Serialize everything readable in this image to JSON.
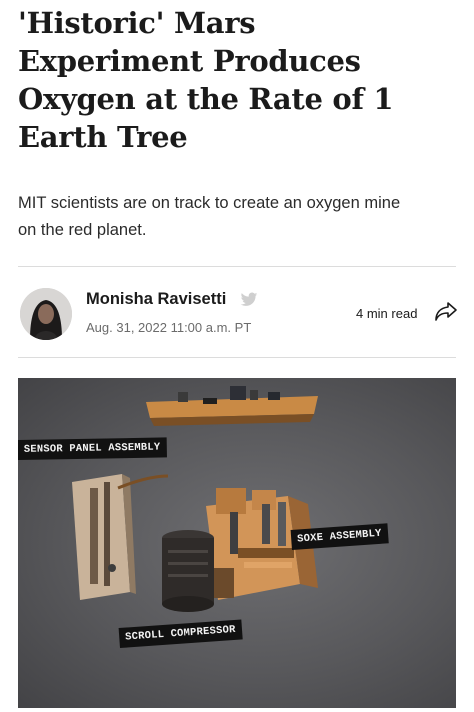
{
  "article": {
    "headline_lines": [
      "'Historic' Mars",
      "Experiment Produces",
      "Oxygen at the Rate of 1",
      "Earth Tree"
    ],
    "dek_lines": [
      "MIT scientists are on track to create an oxygen mine",
      "on the red planet."
    ]
  },
  "author": {
    "name": "Monisha Ravisetti",
    "date": "Aug. 31, 2022 11:00 a.m. PT",
    "twitter_icon": "twitter-icon",
    "avatar": "avatar"
  },
  "meta": {
    "read_time": "4 min read",
    "share_icon": "share-icon"
  },
  "hero_image": {
    "labels": {
      "sensor": "SENSOR PANEL ASSEMBLY",
      "soxe": "SOXE ASSEMBLY",
      "scroll": "SCROLL COMPRESSOR"
    },
    "colors": {
      "background": "#58585b",
      "hardware": "#c98a45",
      "callout": "#111111"
    }
  }
}
